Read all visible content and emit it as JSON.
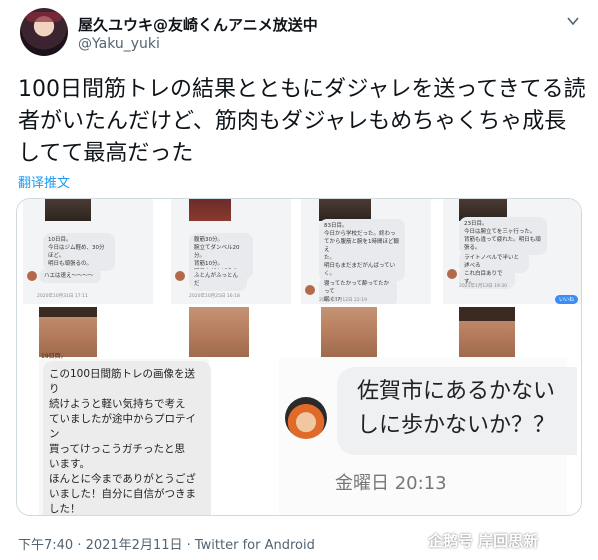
{
  "header": {
    "display_name": "屋久ユウキ@友崎くんアニメ放送中",
    "handle": "@Yaku_yuki"
  },
  "tweet": {
    "text": "100日間筋トレの結果とともにダジャレを送ってきてる読者がいたんだけど、筋肉もダジャレもめちゃくちゃ成長してて最高だった",
    "translate_label": "翻译推文"
  },
  "media": {
    "top_shots": [
      {
        "lines": "10日目。\n今日はジム軽め、30分\nほど。\n明日も頑張るの。",
        "reply": "ハエは速え〜〜〜〜",
        "stamp": "2020年10月31日 17:11"
      },
      {
        "lines": "腹筋30分。\n腕立てダンベル20分。\n背筋10分。\n明日もがんばるの",
        "reply": "ふとんがふっとんだ",
        "stamp": "2020年10月25日 16:18"
      },
      {
        "lines": "83日目。\n今日から学校だった。終わっ\nてから腹筋と腕を1時間ほど鍛え\nた。\n明日もまだまだがんばってい\nく。",
        "reply": "寝ってたかって酔ってたかって\n眠く!?",
        "stamp": "2021年1月12日 22:19"
      },
      {
        "lines": "23日目。\n今日は腕立てを三ヶ行った。\n背筋も違って疲れた。明日も頑\n張る。",
        "reply": "ライトノベルで半いと述べる",
        "reply2": "これ白目ありです。",
        "stamp": "2021年1月13日 19:30",
        "pill": "いいね"
      }
    ],
    "day_label": "19日目。",
    "left_message": "この100日間筋トレの画像を送り\n続けようと軽い気持ちで考え\nていましたが途中からプロテイン\n買ってけっこうガチったと思\nいます。\nほんとに今までありがとうござ\nいました！自分に自信がつきま\nした！\n俺は佐賀県に住んでいますがそれ\nを踏まえて最後のダジャレは\nこれです。",
    "right_message": "佐賀市にあるかない\nしに歩かないか？？",
    "right_time": "金曜日 20:13"
  },
  "footer": {
    "meta": "下午7:40 · 2021年2月11日 · Twitter for Android"
  },
  "watermark": "企鹅号 岸回思新",
  "colors": {
    "link": "#1d9bf0",
    "secondary_text": "#536471",
    "border": "#cfd9de"
  },
  "icons": {
    "menu": "chevron-down-icon"
  }
}
